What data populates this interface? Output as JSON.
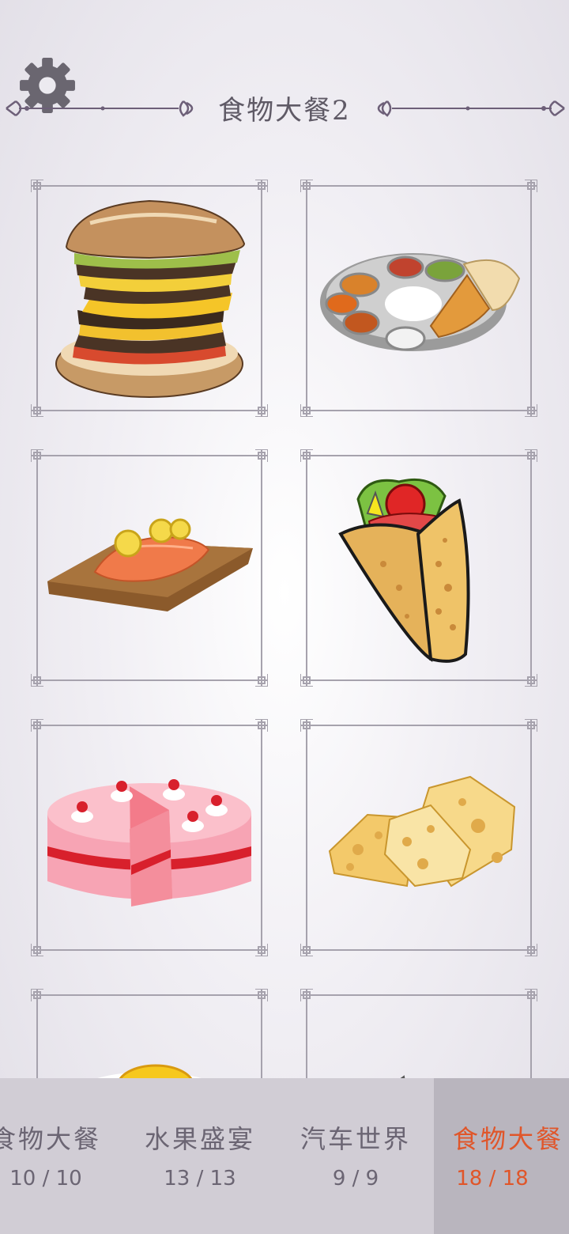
{
  "header": {
    "title": "食物大餐2",
    "settings_icon": "gear-icon"
  },
  "colors": {
    "accent": "#e0562a",
    "text": "#6b6573",
    "tab_bar": "#d1cdd5",
    "tab_active": "#b9b5be",
    "frame": "#a6a2ad"
  },
  "puzzles": [
    {
      "name": "burger",
      "icon": "burger-icon"
    },
    {
      "name": "thali-plate",
      "icon": "thali-plate-icon"
    },
    {
      "name": "salmon-board",
      "icon": "salmon-icon"
    },
    {
      "name": "wrap",
      "icon": "wrap-icon"
    },
    {
      "name": "cake",
      "icon": "cake-icon"
    },
    {
      "name": "cheese",
      "icon": "cheese-icon"
    },
    {
      "name": "egg",
      "icon": "fried-egg-icon"
    },
    {
      "name": "fish",
      "icon": "fish-icon"
    }
  ],
  "categories": [
    {
      "name": "食物大餐",
      "count": "10 / 10",
      "active": false
    },
    {
      "name": "水果盛宴",
      "count": "13 / 13",
      "active": false
    },
    {
      "name": "汽车世界",
      "count": "9 / 9",
      "active": false
    },
    {
      "name": "食物大餐",
      "count": "18 / 18",
      "active": true
    }
  ]
}
